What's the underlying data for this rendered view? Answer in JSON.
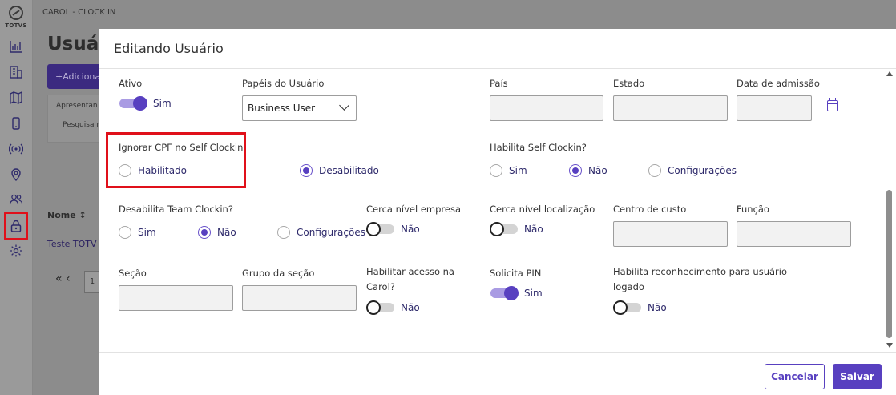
{
  "sidebar": {
    "brand": "TOTVS",
    "icons": [
      "logo-icon",
      "chart-icon",
      "building-icon",
      "map-icon",
      "device-icon",
      "signal-icon",
      "location-pin-icon",
      "users-icon",
      "lock-icon",
      "gear-icon"
    ]
  },
  "background": {
    "breadcrumb": "CAROL - CLOCK IN",
    "page_title": "Usuá",
    "add_button": "+Adiciona",
    "present_label": "Apresentan",
    "search_label": "Pesquisa r",
    "name_header": "Nome ↕",
    "row_text": "Teste TOTV",
    "pager_arrows": "« ‹",
    "pager_page": "1"
  },
  "modal": {
    "title": "Editando Usuário",
    "fields": {
      "ativo": {
        "label": "Ativo",
        "toggle_label": "Sim"
      },
      "papeis": {
        "label": "Papéis do Usuário",
        "value": "Business User"
      },
      "pais": {
        "label": "País",
        "value": ""
      },
      "estado": {
        "label": "Estado",
        "value": ""
      },
      "data_admissao": {
        "label": "Data de admissão",
        "value": ""
      },
      "ignorar_cpf": {
        "label": "Ignorar CPF no Self Clockin",
        "opt_habilitado": "Habilitado",
        "opt_desabilitado": "Desabilitado"
      },
      "habilita_self": {
        "label": "Habilita Self Clockin?",
        "opt_sim": "Sim",
        "opt_nao": "Não",
        "opt_config": "Configurações"
      },
      "desabilita_team": {
        "label": "Desabilita Team Clockin?",
        "opt_sim": "Sim",
        "opt_nao": "Não",
        "opt_config": "Configurações"
      },
      "cerca_empresa": {
        "label": "Cerca nível empresa",
        "toggle_label": "Não"
      },
      "cerca_localizacao": {
        "label": "Cerca nível localização",
        "toggle_label": "Não"
      },
      "centro_custo": {
        "label": "Centro de custo",
        "value": ""
      },
      "funcao": {
        "label": "Função",
        "value": ""
      },
      "secao": {
        "label": "Seção",
        "value": ""
      },
      "grupo_secao": {
        "label": "Grupo da seção",
        "value": ""
      },
      "habilitar_acesso": {
        "label": "Habilitar acesso na Carol?",
        "toggle_label": "Não"
      },
      "solicita_pin": {
        "label": "Solicita PIN",
        "toggle_label": "Sim"
      },
      "reconhecimento": {
        "label": "Habilita reconhecimento para usuário logado",
        "toggle_label": "Não"
      }
    },
    "footer": {
      "cancel": "Cancelar",
      "save": "Salvar"
    }
  },
  "colors": {
    "accent": "#5840c0",
    "highlight": "#e0101a"
  }
}
